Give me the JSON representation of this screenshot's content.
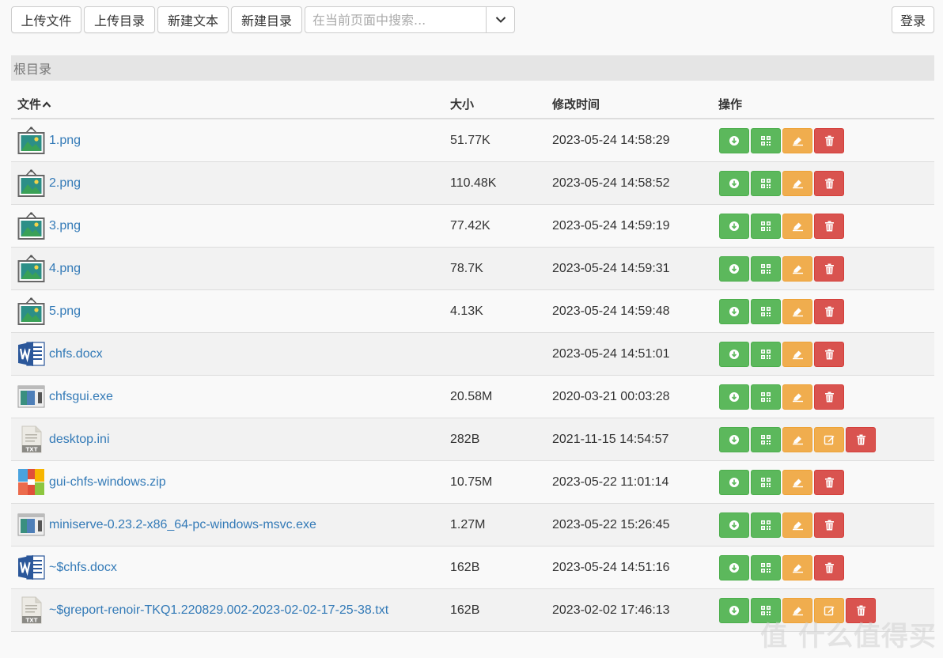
{
  "toolbar": {
    "upload_file": "上传文件",
    "upload_dir": "上传目录",
    "new_text": "新建文本",
    "new_dir": "新建目录",
    "search_placeholder": "在当前页面中搜索...",
    "login": "登录"
  },
  "breadcrumb": {
    "root": "根目录"
  },
  "table": {
    "headers": {
      "file": "文件",
      "size": "大小",
      "modified": "修改时间",
      "actions": "操作"
    },
    "rows": [
      {
        "name": "1.png",
        "size": "51.77K",
        "modified": "2023-05-24 14:58:29",
        "icon": "image-file-icon",
        "editable": false
      },
      {
        "name": "2.png",
        "size": "110.48K",
        "modified": "2023-05-24 14:58:52",
        "icon": "image-file-icon",
        "editable": false
      },
      {
        "name": "3.png",
        "size": "77.42K",
        "modified": "2023-05-24 14:59:19",
        "icon": "image-file-icon",
        "editable": false
      },
      {
        "name": "4.png",
        "size": "78.7K",
        "modified": "2023-05-24 14:59:31",
        "icon": "image-file-icon",
        "editable": false
      },
      {
        "name": "5.png",
        "size": "4.13K",
        "modified": "2023-05-24 14:59:48",
        "icon": "image-file-icon",
        "editable": false
      },
      {
        "name": "chfs.docx",
        "size": "",
        "modified": "2023-05-24 14:51:01",
        "icon": "word-file-icon",
        "editable": false
      },
      {
        "name": "chfsgui.exe",
        "size": "20.58M",
        "modified": "2020-03-21 00:03:28",
        "icon": "exe-file-icon",
        "editable": false
      },
      {
        "name": "desktop.ini",
        "size": "282B",
        "modified": "2021-11-15 14:54:57",
        "icon": "txt-file-icon",
        "editable": true
      },
      {
        "name": "gui-chfs-windows.zip",
        "size": "10.75M",
        "modified": "2023-05-22 11:01:14",
        "icon": "zip-file-icon",
        "editable": false
      },
      {
        "name": "miniserve-0.23.2-x86_64-pc-windows-msvc.exe",
        "size": "1.27M",
        "modified": "2023-05-22 15:26:45",
        "icon": "exe-file-icon",
        "editable": false
      },
      {
        "name": "~$chfs.docx",
        "size": "162B",
        "modified": "2023-05-24 14:51:16",
        "icon": "word-file-icon",
        "editable": false
      },
      {
        "name": "~$greport-renoir-TKQ1.220829.002-2023-02-02-17-25-38.txt",
        "size": "162B",
        "modified": "2023-02-02 17:46:13",
        "icon": "txt-file-icon",
        "editable": true
      }
    ]
  },
  "watermark": "值 什么值得买",
  "colors": {
    "link": "#337ab7",
    "success": "#5cb85c",
    "warning": "#f0ad4e",
    "danger": "#d9534f"
  }
}
